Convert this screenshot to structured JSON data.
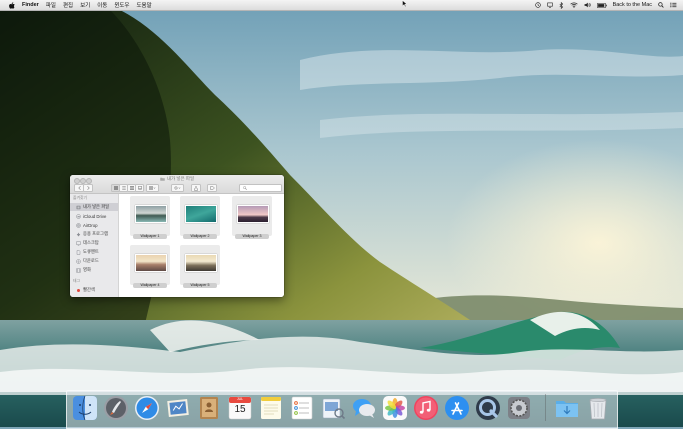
{
  "menubar": {
    "app_name": "Finder",
    "items": [
      "파일",
      "편집",
      "보기",
      "이동",
      "윈도우",
      "도움말"
    ],
    "user_label": "Back to the Mac"
  },
  "finder": {
    "title": "내가 넣은 파일",
    "sidebar": {
      "favorites_header": "즐겨찾기",
      "items": [
        {
          "label": "내가 넣은 파일",
          "icon": "all-files-icon",
          "selected": true
        },
        {
          "label": "iCloud Drive",
          "icon": "cloud-icon"
        },
        {
          "label": "AirDrop",
          "icon": "airdrop-icon"
        },
        {
          "label": "응용 프로그램",
          "icon": "applications-icon"
        },
        {
          "label": "데스크탑",
          "icon": "desktop-icon"
        },
        {
          "label": "도큐멘트",
          "icon": "documents-icon"
        },
        {
          "label": "다운로드",
          "icon": "downloads-icon"
        },
        {
          "label": "영화",
          "icon": "movies-icon"
        }
      ],
      "tags_header": "태그",
      "tags": [
        {
          "label": "빨간색",
          "color": "#e0463c"
        }
      ]
    },
    "files": [
      {
        "name": "Wallpaper 1"
      },
      {
        "name": "Wallpaper 2"
      },
      {
        "name": "Wallpaper 3"
      },
      {
        "name": "Wallpaper 4"
      },
      {
        "name": "Wallpaper 5"
      }
    ]
  },
  "dock": {
    "apps": [
      "finder-icon",
      "launchpad-icon",
      "safari-icon",
      "mail-icon",
      "contacts-icon",
      "calendar-icon",
      "notes-icon",
      "reminders-icon",
      "preview-icon",
      "messages-icon",
      "photos-icon",
      "itunes-icon",
      "app-store-icon",
      "quicktime-icon",
      "system-preferences-icon",
      "downloads-folder-icon",
      "trash-icon"
    ],
    "calendar_month": "JUL",
    "calendar_day": "15"
  }
}
